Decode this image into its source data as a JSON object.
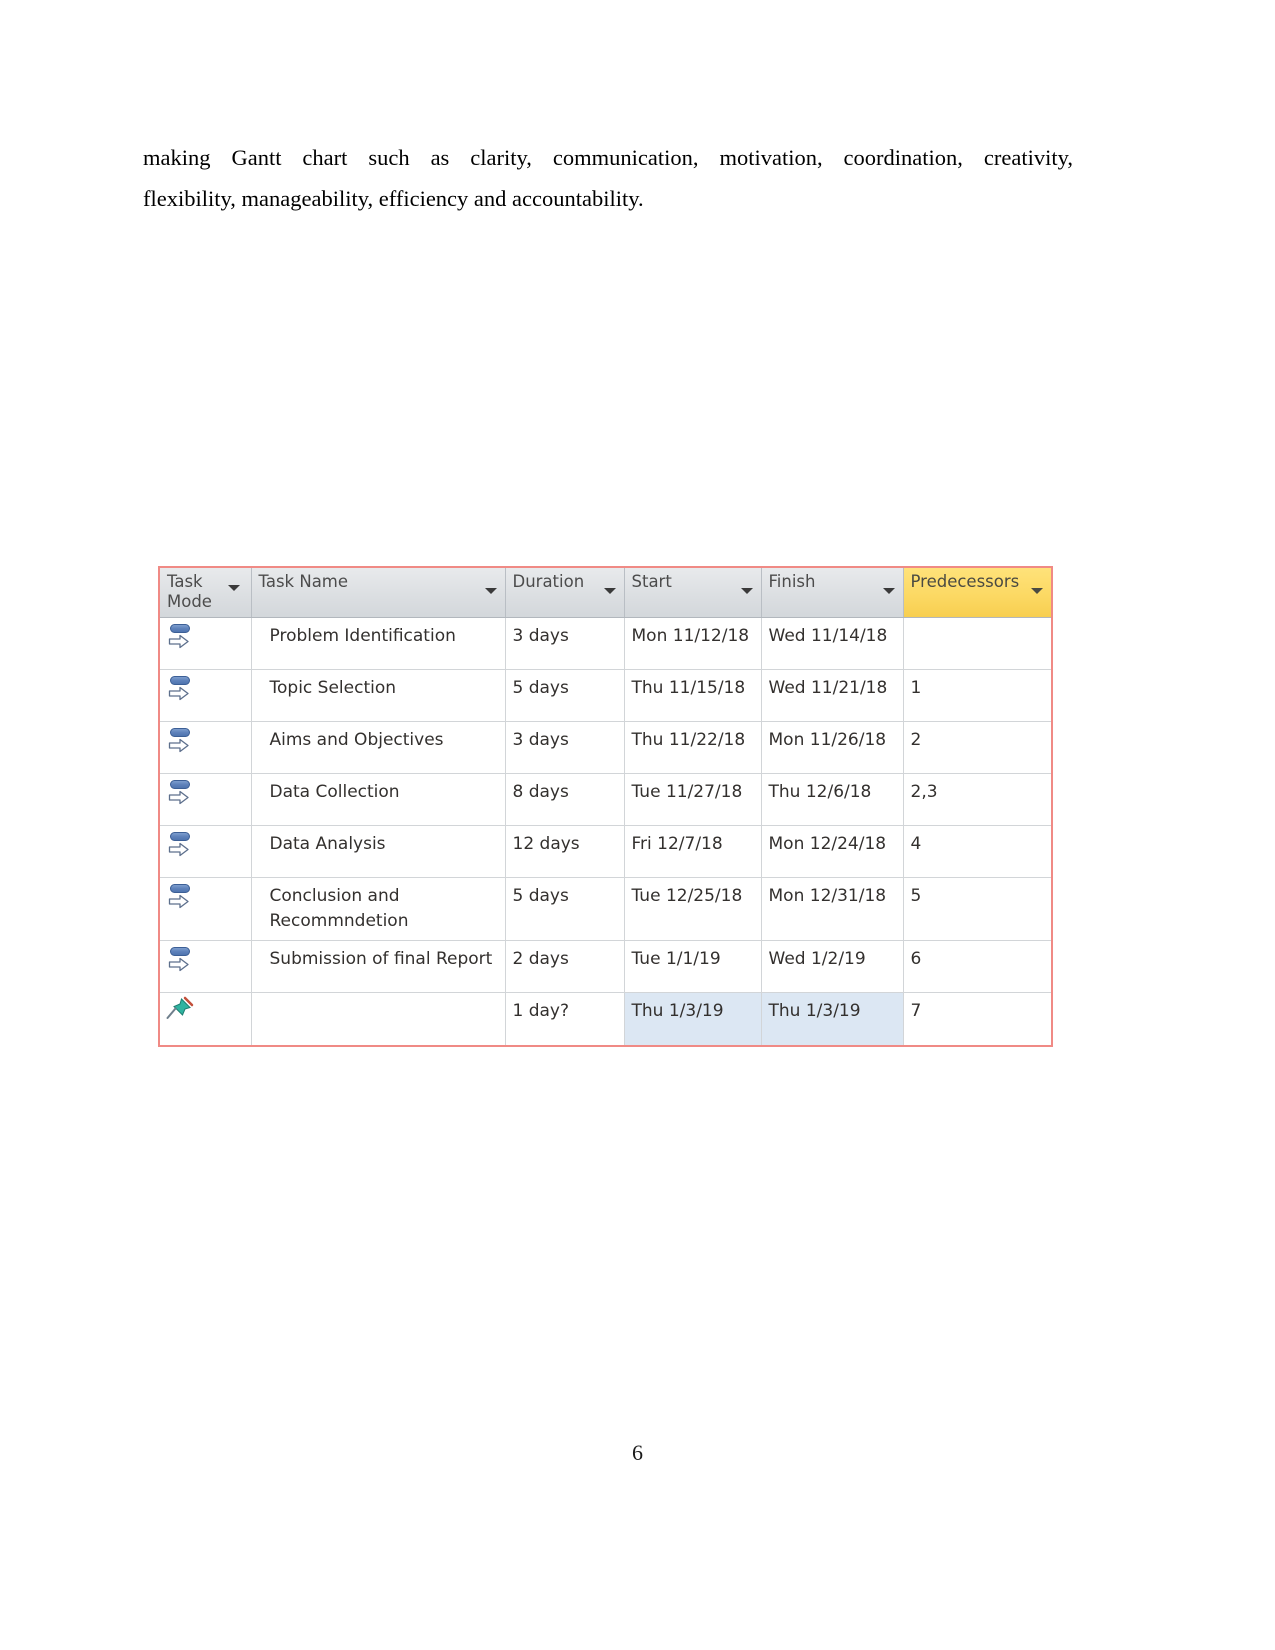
{
  "document": {
    "paragraph_line_1": "making Gantt chart such as clarity, communication, motivation, coordination, creativity,",
    "paragraph_line_2": "flexibility, manageability, efficiency and accountability.",
    "page_number": "6"
  },
  "project_table": {
    "columns": [
      {
        "key": "task_mode",
        "label": "Task Mode",
        "filter_icon": "chevron-down-icon"
      },
      {
        "key": "task_name",
        "label": "Task Name",
        "filter_icon": "chevron-down-icon"
      },
      {
        "key": "duration",
        "label": "Duration",
        "filter_icon": "chevron-down-icon"
      },
      {
        "key": "start",
        "label": "Start",
        "filter_icon": "chevron-down-icon"
      },
      {
        "key": "finish",
        "label": "Finish",
        "filter_icon": "chevron-down-icon"
      },
      {
        "key": "predecessors",
        "label": "Predecessors",
        "filter_icon": "chevron-down-icon"
      }
    ],
    "header_highlight_color": "#fcd964",
    "selection_color": "#dce7f3",
    "border_color": "#f08a85",
    "rows": [
      {
        "mode_icon": "auto-scheduled-icon",
        "task_name": "Problem Identification",
        "duration": "3 days",
        "start": "Mon 11/12/18",
        "finish": "Wed 11/14/18",
        "predecessors": ""
      },
      {
        "mode_icon": "auto-scheduled-icon",
        "task_name": "Topic Selection",
        "duration": "5 days",
        "start": "Thu 11/15/18",
        "finish": "Wed 11/21/18",
        "predecessors": "1"
      },
      {
        "mode_icon": "auto-scheduled-icon",
        "task_name": "Aims and Objectives",
        "duration": "3 days",
        "start": "Thu 11/22/18",
        "finish": "Mon 11/26/18",
        "predecessors": "2"
      },
      {
        "mode_icon": "auto-scheduled-icon",
        "task_name": "Data Collection",
        "duration": "8 days",
        "start": "Tue 11/27/18",
        "finish": "Thu 12/6/18",
        "predecessors": "2,3"
      },
      {
        "mode_icon": "auto-scheduled-icon",
        "task_name": "Data Analysis",
        "duration": "12 days",
        "start": "Fri 12/7/18",
        "finish": "Mon 12/24/18",
        "predecessors": "4"
      },
      {
        "mode_icon": "auto-scheduled-icon",
        "task_name": "Conclusion and Recommndetion",
        "duration": "5 days",
        "start": "Tue 12/25/18",
        "finish": "Mon 12/31/18",
        "predecessors": "5"
      },
      {
        "mode_icon": "auto-scheduled-icon",
        "task_name": "Submission of final Report",
        "duration": "2 days",
        "start": "Tue 1/1/19",
        "finish": "Wed 1/2/19",
        "predecessors": "6"
      },
      {
        "mode_icon": "manually-scheduled-pin-icon",
        "task_name": "",
        "duration": "1 day?",
        "start": "Thu 1/3/19",
        "finish": "Thu 1/3/19",
        "predecessors": "7",
        "selected_cells": [
          "start",
          "finish"
        ]
      }
    ]
  }
}
